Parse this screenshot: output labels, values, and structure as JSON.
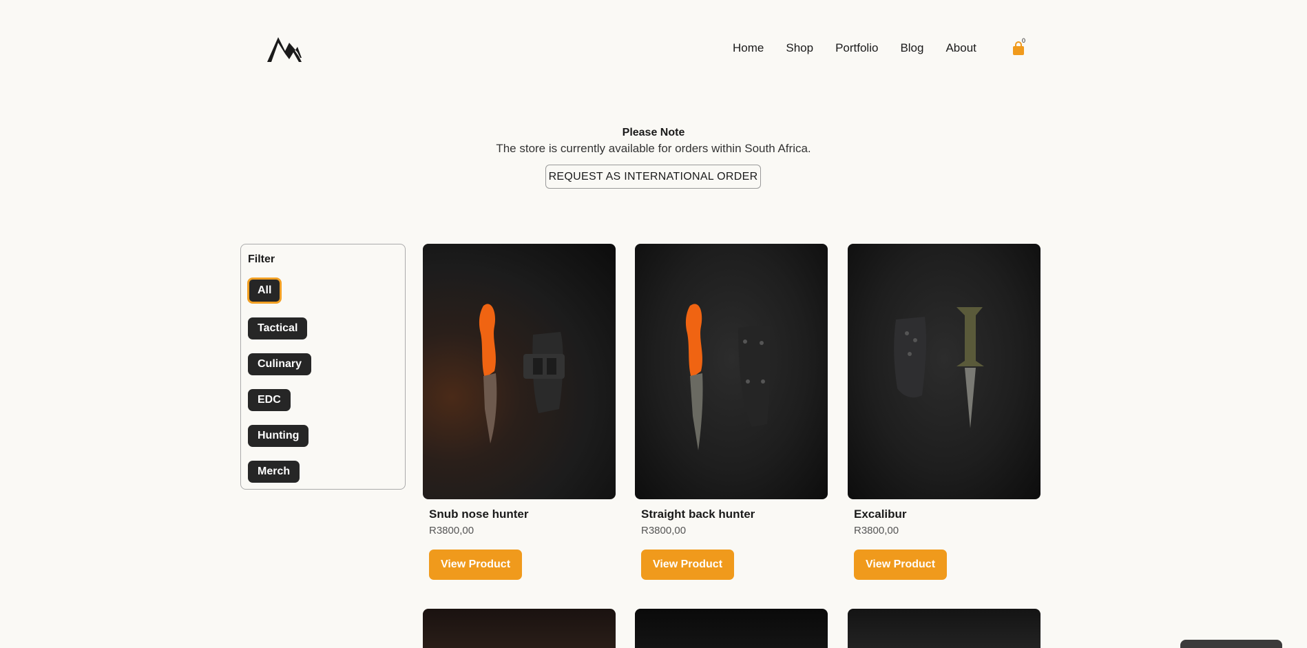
{
  "nav": {
    "items": [
      "Home",
      "Shop",
      "Portfolio",
      "Blog",
      "About"
    ],
    "cart_count": "0",
    "logo_icon": "mountain-m-logo",
    "cart_icon": "shopping-bag-icon"
  },
  "notice": {
    "title": "Please Note",
    "text": "The store is currently available for orders within South Africa.",
    "button_label": "REQUEST AS INTERNATIONAL ORDER"
  },
  "filter": {
    "title": "Filter",
    "options": [
      "All",
      "Tactical",
      "Culinary",
      "EDC",
      "Hunting",
      "Merch"
    ],
    "selected": "All"
  },
  "products": [
    {
      "name": "Snub nose hunter",
      "price": "R3800,00",
      "button": "View Product"
    },
    {
      "name": "Straight back hunter",
      "price": "R3800,00",
      "button": "View Product"
    },
    {
      "name": "Excalibur",
      "price": "R3800,00",
      "button": "View Product"
    }
  ],
  "colors": {
    "accent": "#f09a1c",
    "chip_bg": "#262626",
    "page_bg": "#faf9f5"
  }
}
